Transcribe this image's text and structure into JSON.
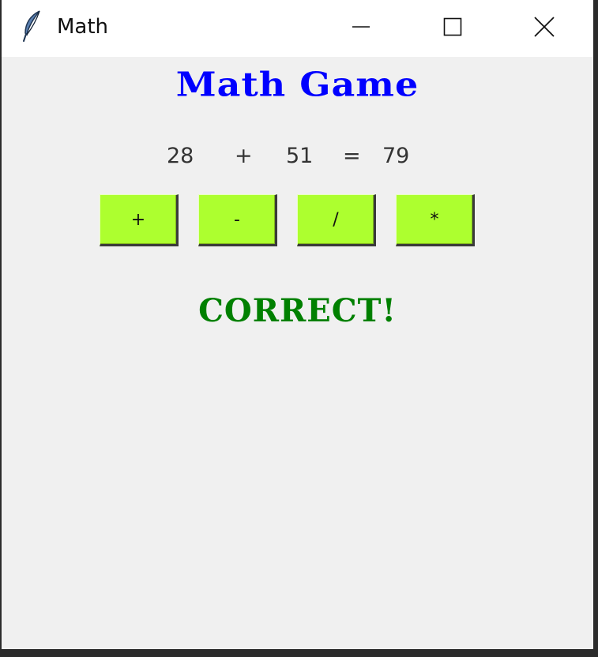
{
  "window": {
    "title": "Math"
  },
  "game": {
    "title": "Math Game",
    "equation": {
      "left": "28",
      "operator": "+",
      "right": "51",
      "equals": "=",
      "result": "79"
    },
    "buttons": [
      {
        "label": "+"
      },
      {
        "label": "-"
      },
      {
        "label": "/"
      },
      {
        "label": "*"
      }
    ],
    "status": "CORRECT!"
  },
  "colors": {
    "title": "#0000ff",
    "status": "#008000",
    "button": "#adff2f",
    "background": "#f0f0f0"
  },
  "icons": {
    "app": "feather-icon",
    "minimize": "minimize-icon",
    "maximize": "maximize-icon",
    "close": "close-icon"
  }
}
